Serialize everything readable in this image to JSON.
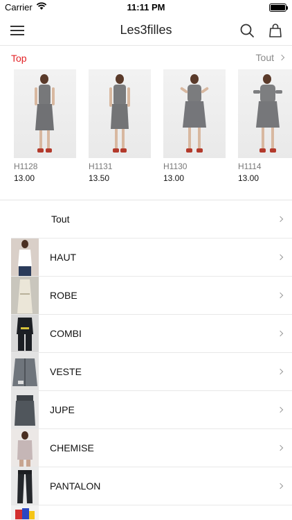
{
  "status": {
    "carrier": "Carrier",
    "time": "11:11 PM"
  },
  "nav": {
    "title": "Les3filles"
  },
  "top": {
    "label": "Top",
    "see_all": "Tout",
    "products": [
      {
        "ref": "H1128",
        "price": "13.00"
      },
      {
        "ref": "H1131",
        "price": "13.50"
      },
      {
        "ref": "H1130",
        "price": "13.00"
      },
      {
        "ref": "H1114",
        "price": "13.00"
      }
    ]
  },
  "categories": [
    {
      "label": "Tout"
    },
    {
      "label": "HAUT"
    },
    {
      "label": "ROBE"
    },
    {
      "label": "COMBI"
    },
    {
      "label": "VESTE"
    },
    {
      "label": "JUPE"
    },
    {
      "label": "CHEMISE"
    },
    {
      "label": "PANTALON"
    },
    {
      "label": ""
    }
  ],
  "colors": {
    "accent": "#e32226",
    "muted": "#888888",
    "divider": "#e8e8e8"
  }
}
